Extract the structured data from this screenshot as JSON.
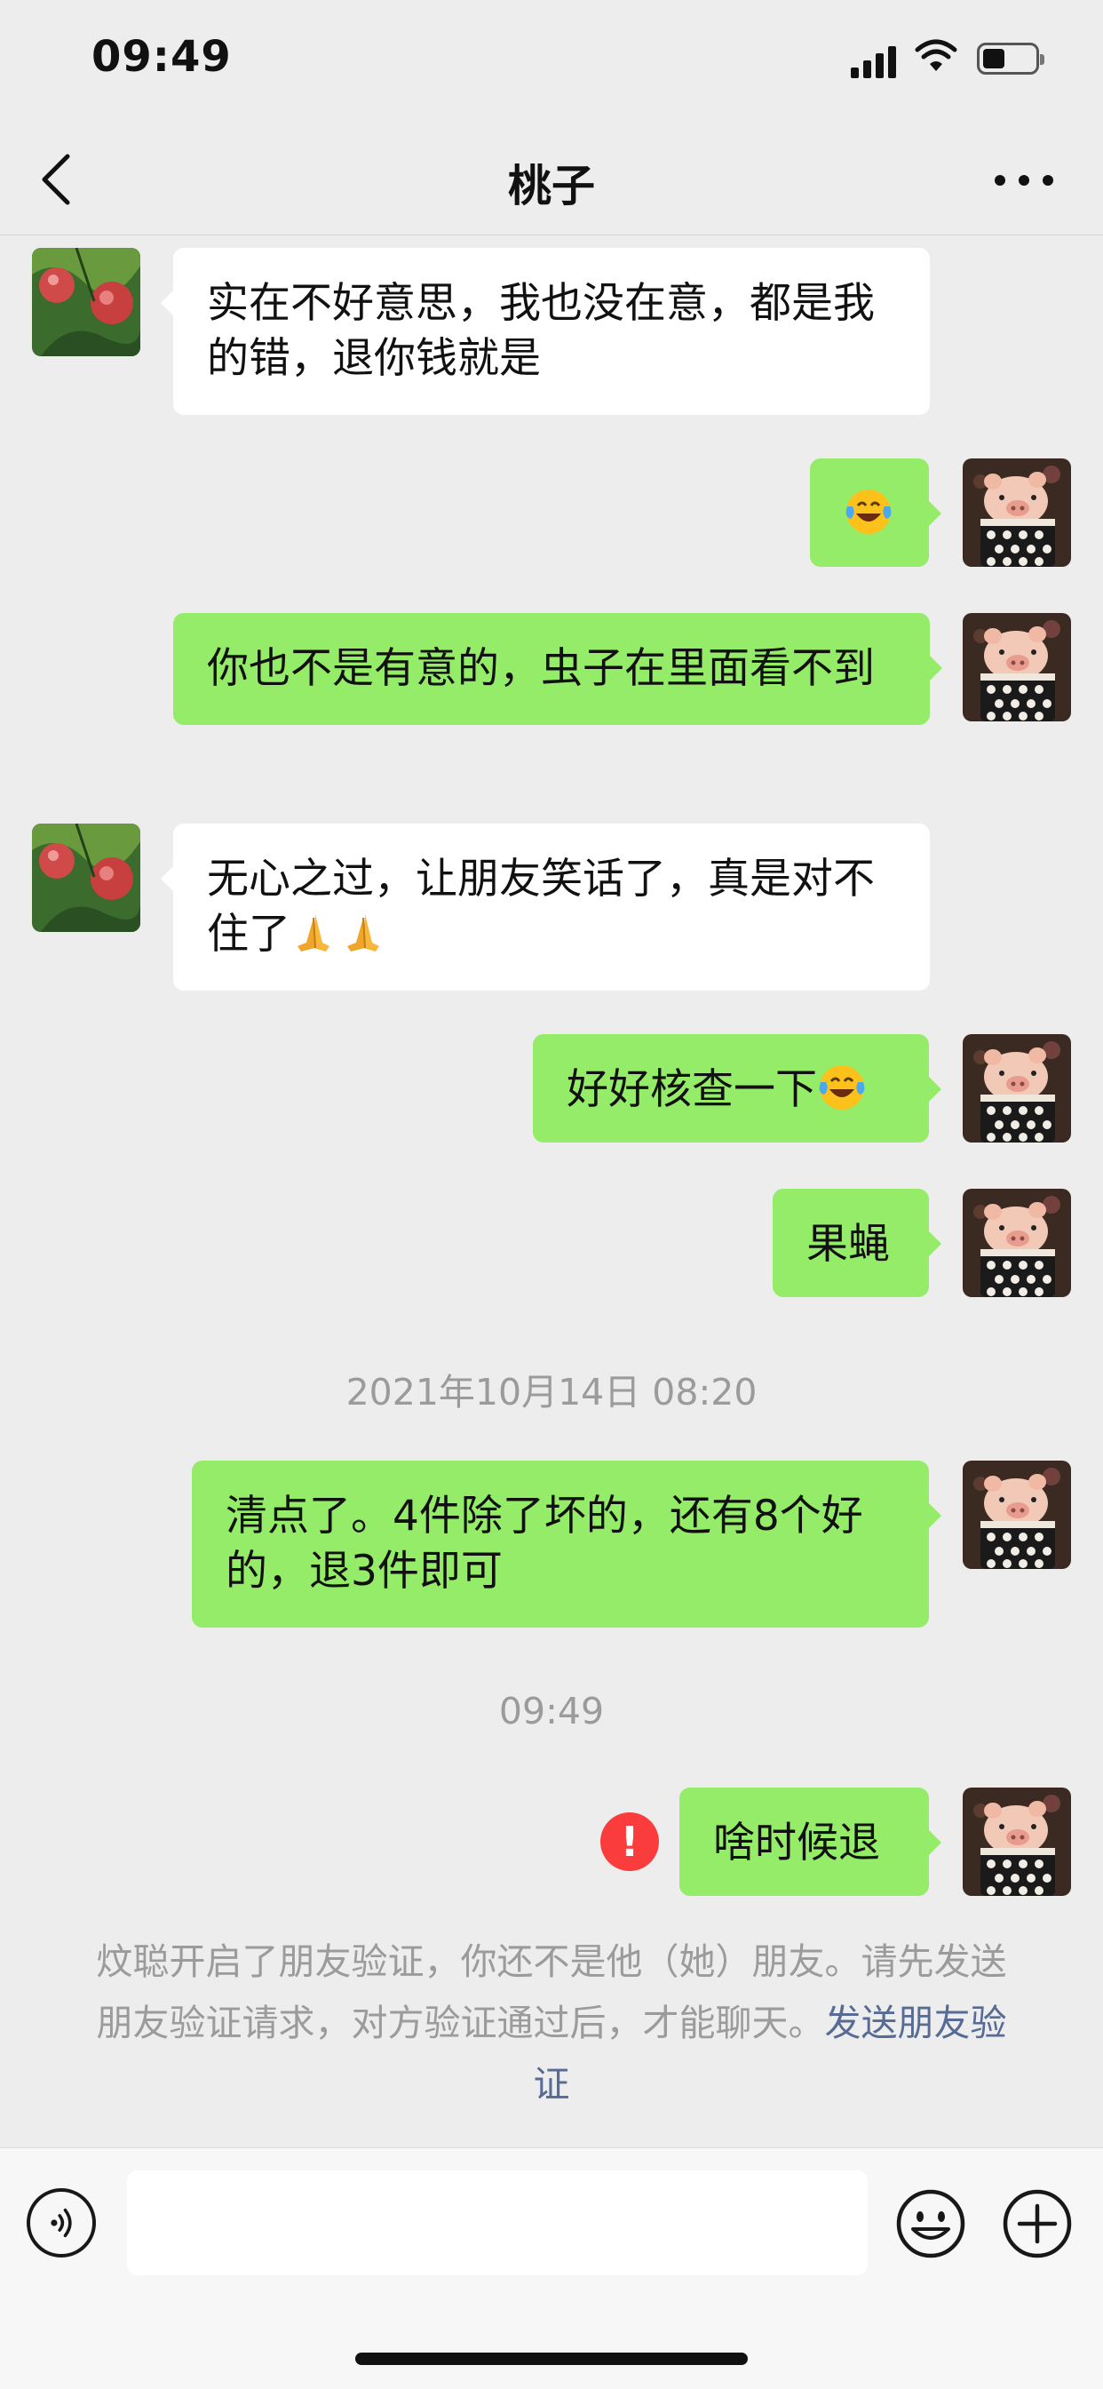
{
  "status_bar": {
    "time": "09:49"
  },
  "nav": {
    "title": "桃子"
  },
  "messages": [
    {
      "from": "contact",
      "text": "实在不好意思，我也没在意，都是我的错，退你钱就是"
    },
    {
      "from": "me",
      "emoji": "tears-of-joy-emoji"
    },
    {
      "from": "me",
      "text": "你也不是有意的，虫子在里面看不到"
    },
    {
      "from": "contact",
      "text": "无心之过，让朋友笑话了，真是对不住了",
      "trailing_emojis": [
        "folded-hands-emoji",
        "folded-hands-emoji"
      ]
    },
    {
      "from": "me",
      "text": "好好核查一下",
      "trailing_emojis": [
        "tears-of-joy-emoji"
      ]
    },
    {
      "from": "me",
      "text": "果蝇"
    },
    {
      "from": "me",
      "text": "清点了。4件除了坏的，还有8个好的，退3件即可"
    },
    {
      "from": "me",
      "text": "啥时候退",
      "status": "send-failed"
    }
  ],
  "timestamps": [
    "2021年10月14日 08:20",
    "09:49"
  ],
  "system_notice": {
    "text": "炆聪开启了朋友验证，你还不是他（她）朋友。请先发送朋友验证请求，对方验证通过后，才能聊天。",
    "link": "发送朋友验证"
  },
  "error_mark": "!",
  "input": {
    "value": "",
    "placeholder": ""
  },
  "colors": {
    "background": "#ededed",
    "outgoing_bubble": "#95ec69",
    "incoming_bubble": "#ffffff",
    "timestamp_text": "#9b9b9b",
    "link": "#576b95",
    "error": "#fa3c3c"
  },
  "icons": [
    "signal-icon",
    "wifi-icon",
    "battery-icon",
    "back-arrow-icon",
    "more-icon",
    "voice-icon",
    "emoji-icon",
    "plus-icon",
    "error-icon"
  ]
}
